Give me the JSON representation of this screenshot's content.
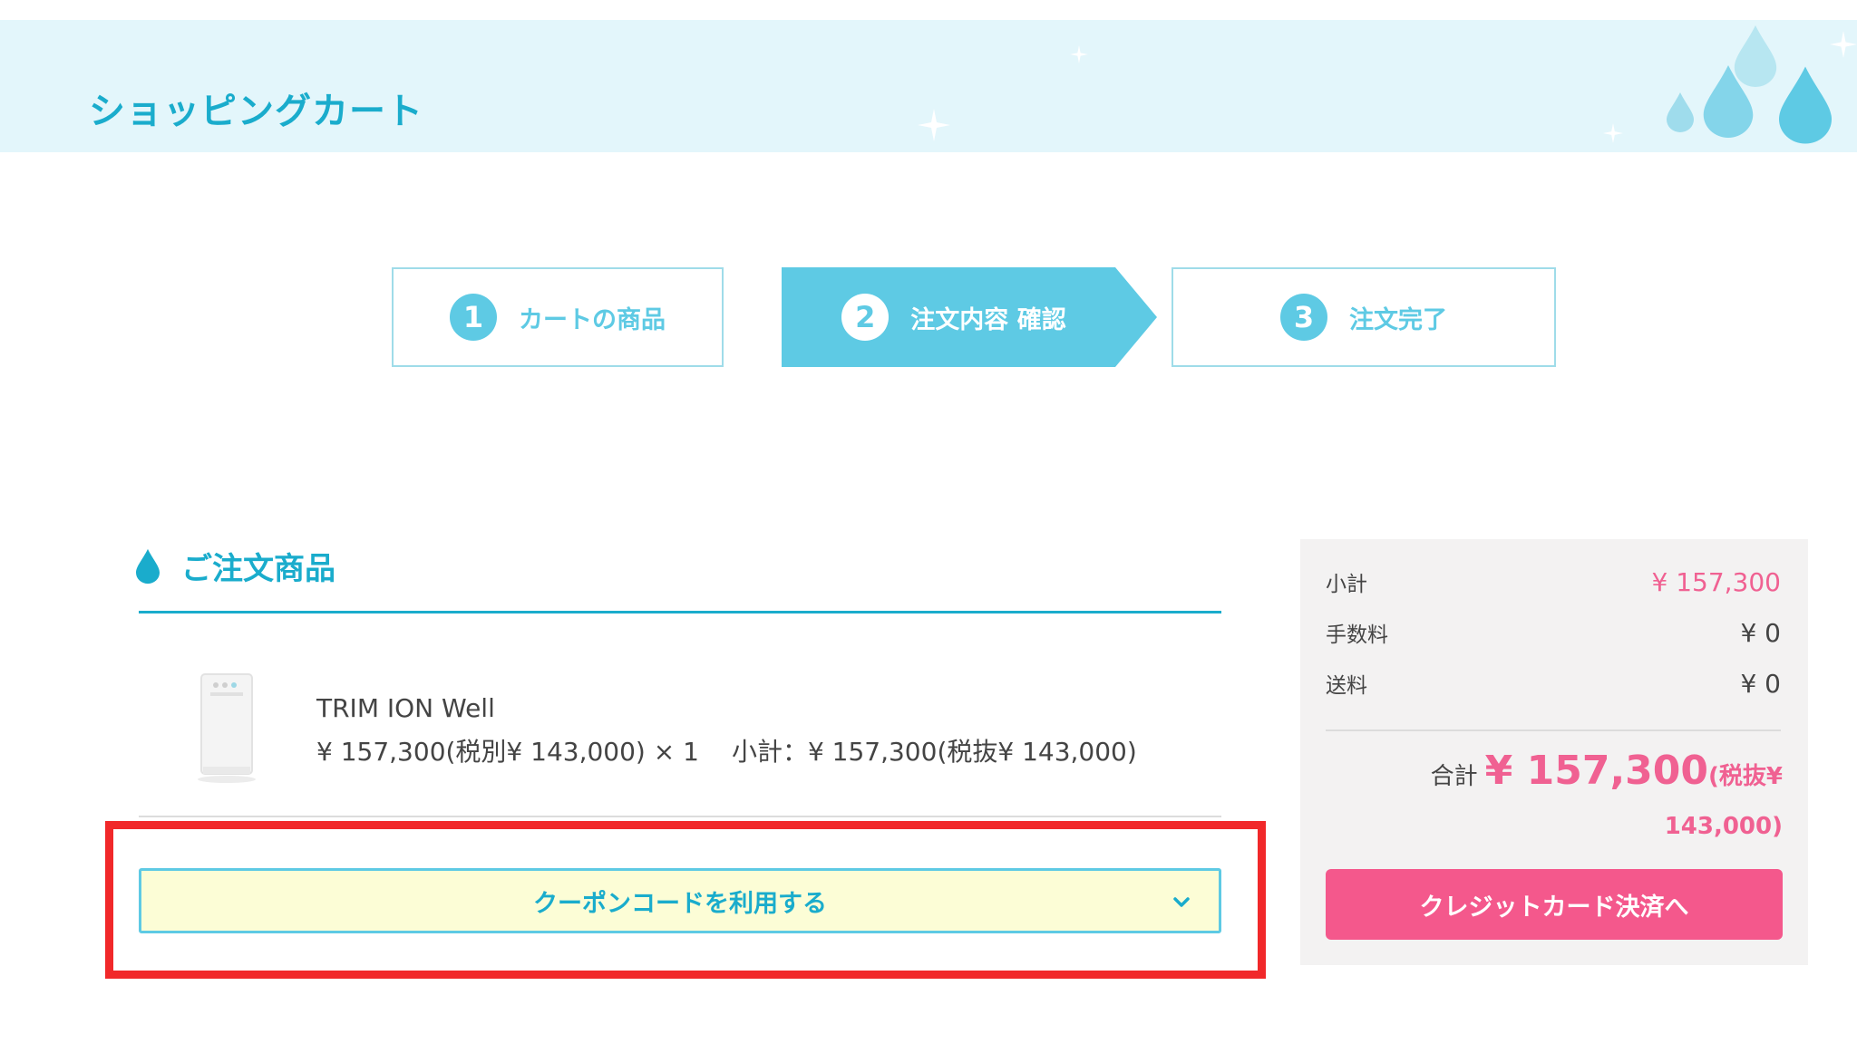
{
  "header": {
    "title": "ショッピングカート"
  },
  "steps": [
    {
      "number": "1",
      "label": "カートの商品"
    },
    {
      "number": "2",
      "label": "注文内容 確認"
    },
    {
      "number": "3",
      "label": "注文完了"
    }
  ],
  "order": {
    "section_title": "ご注文商品",
    "item": {
      "name": "TRIM ION Well",
      "price_qty": "¥ 157,300(税別¥ 143,000) × 1",
      "subtotal": "小計：¥ 157,300(税抜¥ 143,000)"
    },
    "coupon_label": "クーポンコードを利用する"
  },
  "summary": {
    "subtotal_label": "小計",
    "subtotal_value": "¥ 157,300",
    "fee_label": "手数料",
    "fee_value": "¥ 0",
    "shipping_label": "送料",
    "shipping_value": "¥ 0",
    "total_label": "合計",
    "total_value": "¥ 157,300",
    "total_tax_part1": "(税抜¥",
    "total_tax_part2": "143,000)",
    "pay_button": "クレジットカード決済へ"
  },
  "colors": {
    "accent": "#1aaccc",
    "step_blue": "#5ecae4",
    "pink": "#f06192",
    "pay_button": "#f4588c",
    "highlight": "#f1282a",
    "coupon_bg": "#fcfdd6"
  }
}
